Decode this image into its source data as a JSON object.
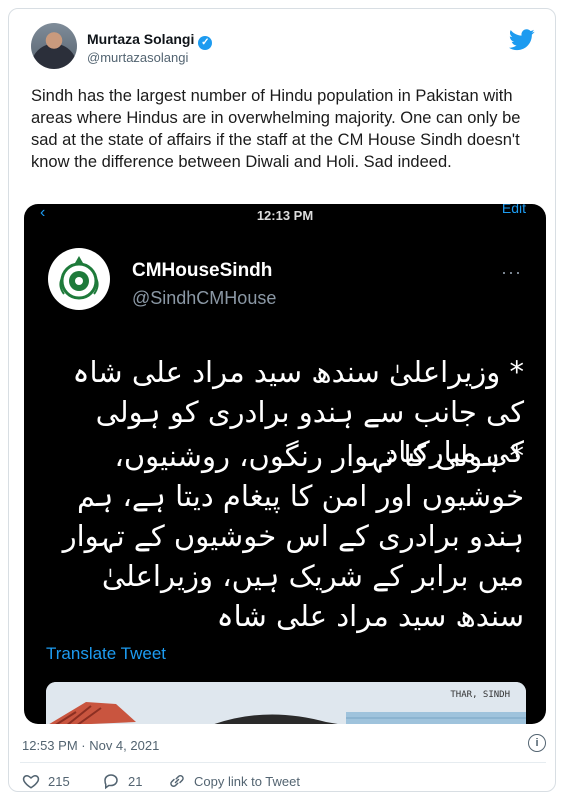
{
  "author": {
    "name": "Murtaza Solangi",
    "handle": "@murtazasolangi"
  },
  "tweet_text": "Sindh has the largest number of Hindu population in Pakistan with areas where Hindus are in overwhelming majority. One can only be sad at the state of affairs if the staff at the CM House Sindh doesn't know the difference between Diwali and Holi. Sad indeed.",
  "embedded": {
    "status_time": "12:13 PM",
    "edit_fragment": "Edit",
    "name": "CMHouseSindh",
    "handle": "@SindhCMHouse",
    "urdu_para_1": "* وزیراعلیٰ سندھ سید مراد علی شاہ کی جانب سے ہندو برادری کو ہولی کی مبارکباد",
    "urdu_para_2": "* ہولی کا تہوار رنگوں، روشنیوں، خوشیوں اور امن کا پیغام دیتا ہے، ہم ہندو برادری کے اس خوشیوں کے تہوار میں برابر کے شریک ہیں، وزیراعلیٰ سندھ سید مراد علی شاہ",
    "translate_label": "Translate Tweet",
    "image_caption": "THAR, SINDH"
  },
  "timestamp": "12:53 PM · Nov 4, 2021",
  "actions": {
    "likes": "215",
    "replies": "21",
    "copy_link": "Copy link to Tweet"
  },
  "colors": {
    "accent": "#1d9bf0",
    "secondary_text": "#536471",
    "embedded_bg": "#000000"
  }
}
